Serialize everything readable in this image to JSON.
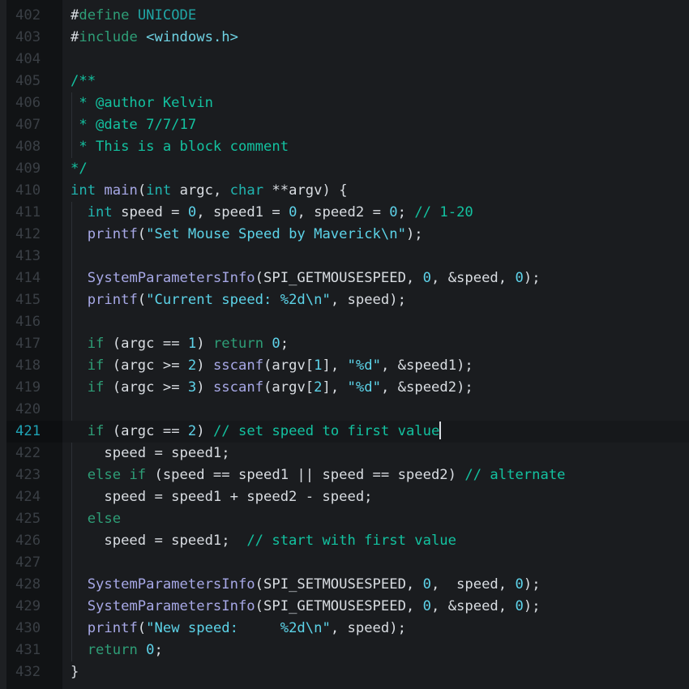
{
  "editor": {
    "language": "C",
    "active_line": 421,
    "colors": {
      "background": "#1a1c1f",
      "gutter_background": "#111315",
      "line_number": "#3a3f45",
      "active_line_number": "#1fa3b5",
      "comment": "#13c2a0",
      "keyword": "#2e9e77",
      "type": "#21b5b0",
      "function": "#a7a8e6",
      "number": "#5ed3ea",
      "string": "#5cd3e8",
      "identifier": "#d9dde2"
    },
    "lines": [
      {
        "n": "402",
        "tokens": [
          [
            "pp",
            "#"
          ],
          [
            "ppkw",
            "define"
          ],
          [
            "id",
            " "
          ],
          [
            "macro",
            "UNICODE"
          ]
        ]
      },
      {
        "n": "403",
        "tokens": [
          [
            "pp",
            "#"
          ],
          [
            "ppkw",
            "include"
          ],
          [
            "id",
            " "
          ],
          [
            "inc",
            "<windows.h>"
          ]
        ]
      },
      {
        "n": "404",
        "tokens": []
      },
      {
        "n": "405",
        "tokens": [
          [
            "cm",
            "/**"
          ]
        ]
      },
      {
        "n": "406",
        "tokens": [
          [
            "cm",
            " * @author Kelvin"
          ]
        ]
      },
      {
        "n": "407",
        "tokens": [
          [
            "cm",
            " * @date 7/7/17"
          ]
        ]
      },
      {
        "n": "408",
        "tokens": [
          [
            "cm",
            " * This is a block comment"
          ]
        ]
      },
      {
        "n": "409",
        "tokens": [
          [
            "cm",
            "*/"
          ]
        ]
      },
      {
        "n": "410",
        "tokens": [
          [
            "type",
            "int"
          ],
          [
            "id",
            " "
          ],
          [
            "fn",
            "main"
          ],
          [
            "id",
            "("
          ],
          [
            "type",
            "int"
          ],
          [
            "id",
            " argc, "
          ],
          [
            "type",
            "char"
          ],
          [
            "id",
            " **argv) {"
          ]
        ]
      },
      {
        "n": "411",
        "tokens": [
          [
            "id",
            "  "
          ],
          [
            "type",
            "int"
          ],
          [
            "id",
            " speed = "
          ],
          [
            "num",
            "0"
          ],
          [
            "id",
            ", speed1 = "
          ],
          [
            "num",
            "0"
          ],
          [
            "id",
            ", speed2 = "
          ],
          [
            "num",
            "0"
          ],
          [
            "id",
            "; "
          ],
          [
            "cm",
            "// 1-20"
          ]
        ]
      },
      {
        "n": "412",
        "tokens": [
          [
            "id",
            "  "
          ],
          [
            "fn",
            "printf"
          ],
          [
            "id",
            "("
          ],
          [
            "str",
            "\"Set Mouse Speed by Maverick\\n\""
          ],
          [
            "id",
            ");"
          ]
        ]
      },
      {
        "n": "413",
        "tokens": []
      },
      {
        "n": "414",
        "tokens": [
          [
            "id",
            "  "
          ],
          [
            "fn",
            "SystemParametersInfo"
          ],
          [
            "id",
            "(SPI_GETMOUSESPEED, "
          ],
          [
            "num",
            "0"
          ],
          [
            "id",
            ", &speed, "
          ],
          [
            "num",
            "0"
          ],
          [
            "id",
            ");"
          ]
        ]
      },
      {
        "n": "415",
        "tokens": [
          [
            "id",
            "  "
          ],
          [
            "fn",
            "printf"
          ],
          [
            "id",
            "("
          ],
          [
            "str",
            "\"Current speed: %2d\\n\""
          ],
          [
            "id",
            ", speed);"
          ]
        ]
      },
      {
        "n": "416",
        "tokens": []
      },
      {
        "n": "417",
        "tokens": [
          [
            "id",
            "  "
          ],
          [
            "kw",
            "if"
          ],
          [
            "id",
            " (argc == "
          ],
          [
            "num",
            "1"
          ],
          [
            "id",
            ") "
          ],
          [
            "kw",
            "return"
          ],
          [
            "id",
            " "
          ],
          [
            "num",
            "0"
          ],
          [
            "id",
            ";"
          ]
        ]
      },
      {
        "n": "418",
        "tokens": [
          [
            "id",
            "  "
          ],
          [
            "kw",
            "if"
          ],
          [
            "id",
            " (argc >= "
          ],
          [
            "num",
            "2"
          ],
          [
            "id",
            ") "
          ],
          [
            "fn",
            "sscanf"
          ],
          [
            "id",
            "(argv["
          ],
          [
            "num",
            "1"
          ],
          [
            "id",
            "], "
          ],
          [
            "str",
            "\"%d\""
          ],
          [
            "id",
            ", &speed1);"
          ]
        ]
      },
      {
        "n": "419",
        "tokens": [
          [
            "id",
            "  "
          ],
          [
            "kw",
            "if"
          ],
          [
            "id",
            " (argc >= "
          ],
          [
            "num",
            "3"
          ],
          [
            "id",
            ") "
          ],
          [
            "fn",
            "sscanf"
          ],
          [
            "id",
            "(argv["
          ],
          [
            "num",
            "2"
          ],
          [
            "id",
            "], "
          ],
          [
            "str",
            "\"%d\""
          ],
          [
            "id",
            ", &speed2);"
          ]
        ]
      },
      {
        "n": "420",
        "tokens": []
      },
      {
        "n": "421",
        "tokens": [
          [
            "id",
            "  "
          ],
          [
            "kw",
            "if"
          ],
          [
            "id",
            " (argc == "
          ],
          [
            "num",
            "2"
          ],
          [
            "id",
            ") "
          ],
          [
            "cm",
            "// set speed to first value"
          ]
        ],
        "caret": true
      },
      {
        "n": "422",
        "tokens": [
          [
            "id",
            "    speed = speed1;"
          ]
        ]
      },
      {
        "n": "423",
        "tokens": [
          [
            "id",
            "  "
          ],
          [
            "kw",
            "else if"
          ],
          [
            "id",
            " (speed == speed1 || speed == speed2) "
          ],
          [
            "cm",
            "// alternate"
          ]
        ]
      },
      {
        "n": "424",
        "tokens": [
          [
            "id",
            "    speed = speed1 + speed2 - speed;"
          ]
        ]
      },
      {
        "n": "425",
        "tokens": [
          [
            "id",
            "  "
          ],
          [
            "kw",
            "else"
          ]
        ]
      },
      {
        "n": "426",
        "tokens": [
          [
            "id",
            "    speed = speed1;  "
          ],
          [
            "cm",
            "// start with first value"
          ]
        ]
      },
      {
        "n": "427",
        "tokens": []
      },
      {
        "n": "428",
        "tokens": [
          [
            "id",
            "  "
          ],
          [
            "fn",
            "SystemParametersInfo"
          ],
          [
            "id",
            "(SPI_SETMOUSESPEED, "
          ],
          [
            "num",
            "0"
          ],
          [
            "id",
            ",  speed, "
          ],
          [
            "num",
            "0"
          ],
          [
            "id",
            ");"
          ]
        ]
      },
      {
        "n": "429",
        "tokens": [
          [
            "id",
            "  "
          ],
          [
            "fn",
            "SystemParametersInfo"
          ],
          [
            "id",
            "(SPI_GETMOUSESPEED, "
          ],
          [
            "num",
            "0"
          ],
          [
            "id",
            ", &speed, "
          ],
          [
            "num",
            "0"
          ],
          [
            "id",
            ");"
          ]
        ]
      },
      {
        "n": "430",
        "tokens": [
          [
            "id",
            "  "
          ],
          [
            "fn",
            "printf"
          ],
          [
            "id",
            "("
          ],
          [
            "str",
            "\"New speed:     %2d\\n\""
          ],
          [
            "id",
            ", speed);"
          ]
        ]
      },
      {
        "n": "431",
        "tokens": [
          [
            "id",
            "  "
          ],
          [
            "kw",
            "return"
          ],
          [
            "id",
            " "
          ],
          [
            "num",
            "0"
          ],
          [
            "id",
            ";"
          ]
        ]
      },
      {
        "n": "432",
        "tokens": [
          [
            "id",
            "}"
          ]
        ]
      }
    ]
  }
}
